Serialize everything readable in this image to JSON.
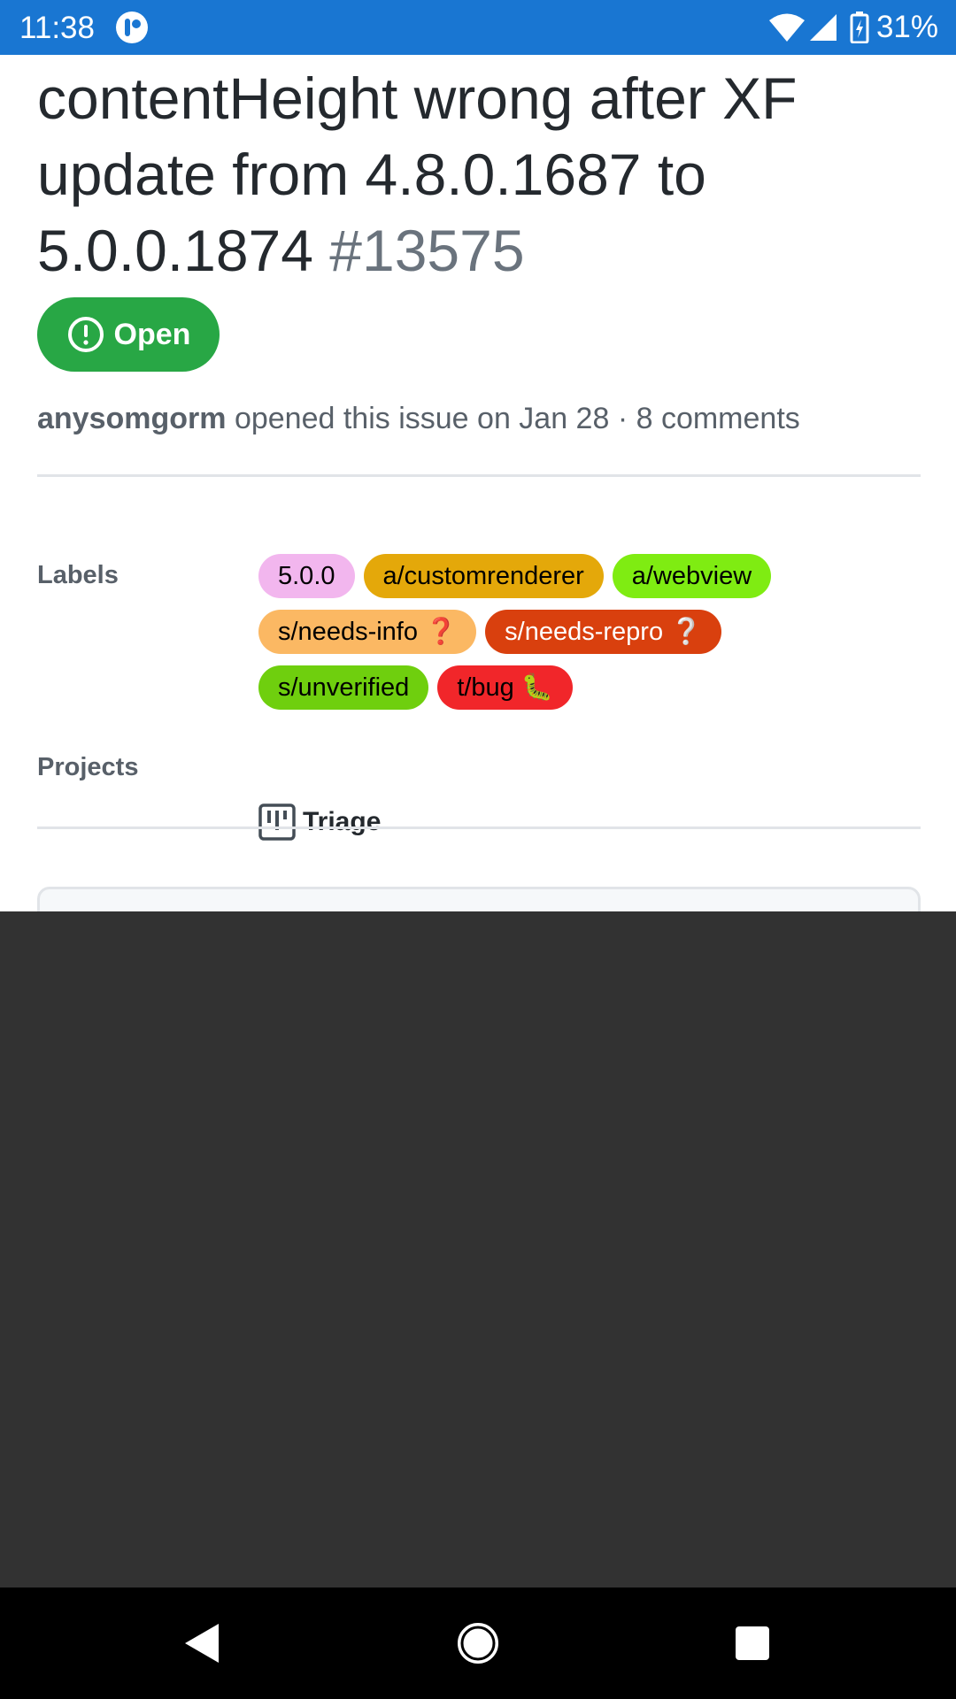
{
  "status_bar": {
    "time": "11:38",
    "battery_percent": "31%",
    "icons": [
      "app-notification-icon",
      "wifi-icon",
      "cell-signal-icon",
      "battery-charging-icon"
    ]
  },
  "issue": {
    "title": "contentHeight wrong after XF update from 4.8.0.1687 to 5.0.0.1874",
    "number": "#13575",
    "state": "Open",
    "author": "anysomgorm",
    "meta": "opened this issue on Jan 28 · 8 comments"
  },
  "sidebar": {
    "labels_heading": "Labels",
    "labels": [
      {
        "text": "5.0.0",
        "bg": "#f2b6ee",
        "fg": "#000000"
      },
      {
        "text": "a/customrenderer",
        "bg": "#e4a80a",
        "fg": "#000000"
      },
      {
        "text": "a/webview",
        "bg": "#7fec12",
        "fg": "#000000"
      },
      {
        "text": "s/needs-info ❓",
        "bg": "#fbb863",
        "fg": "#000000"
      },
      {
        "text": "s/needs-repro ❔",
        "bg": "#d9400e",
        "fg": "#ffffff"
      },
      {
        "text": "s/unverified",
        "bg": "#6fcf0e",
        "fg": "#000000"
      },
      {
        "text": "t/bug 🐛",
        "bg": "#f1262a",
        "fg": "#000000"
      }
    ],
    "projects_heading": "Projects",
    "project": {
      "name": "Triage",
      "icon": "project-board-icon"
    }
  },
  "nav_bar": {
    "icons": [
      "back-icon",
      "home-icon",
      "recents-icon"
    ]
  },
  "colors": {
    "status_bar": "#1976d2",
    "open_badge": "#28a745",
    "dark_area": "#323232",
    "nav_bar": "#000000"
  }
}
